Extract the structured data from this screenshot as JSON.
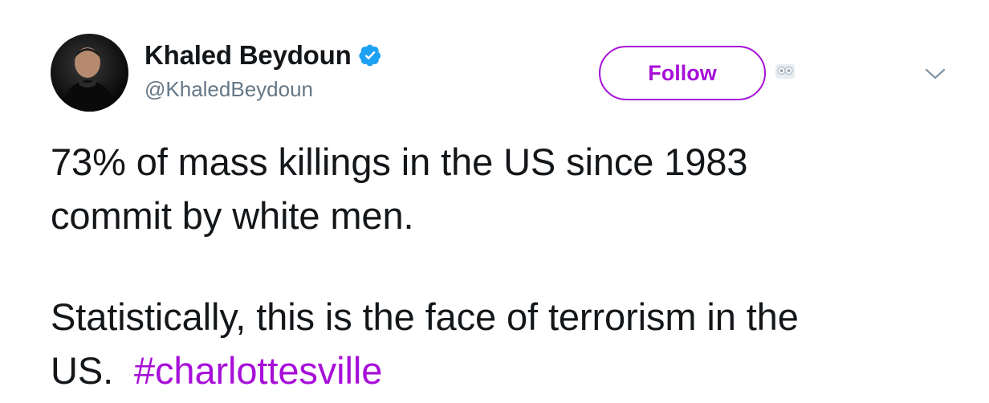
{
  "author": {
    "display_name": "Khaled Beydoun",
    "handle": "@KhaledBeydoun",
    "verified": true
  },
  "follow_button": {
    "label": "Follow"
  },
  "tweet": {
    "line1": "73% of mass killings in the US since 1983",
    "line2": "commit by white men.",
    "line3": "Statistically, this is the face of terrorism in the",
    "line4_prefix": "US.  ",
    "hashtag": "#charlottesville"
  },
  "colors": {
    "accent": "#a70fd8",
    "verified_badge": "#1da1f2",
    "text": "#14171a",
    "secondary_text": "#657786"
  },
  "icons": {
    "verified": "verified-badge-icon",
    "owl": "owl-icon",
    "menu": "chevron-down-icon"
  }
}
